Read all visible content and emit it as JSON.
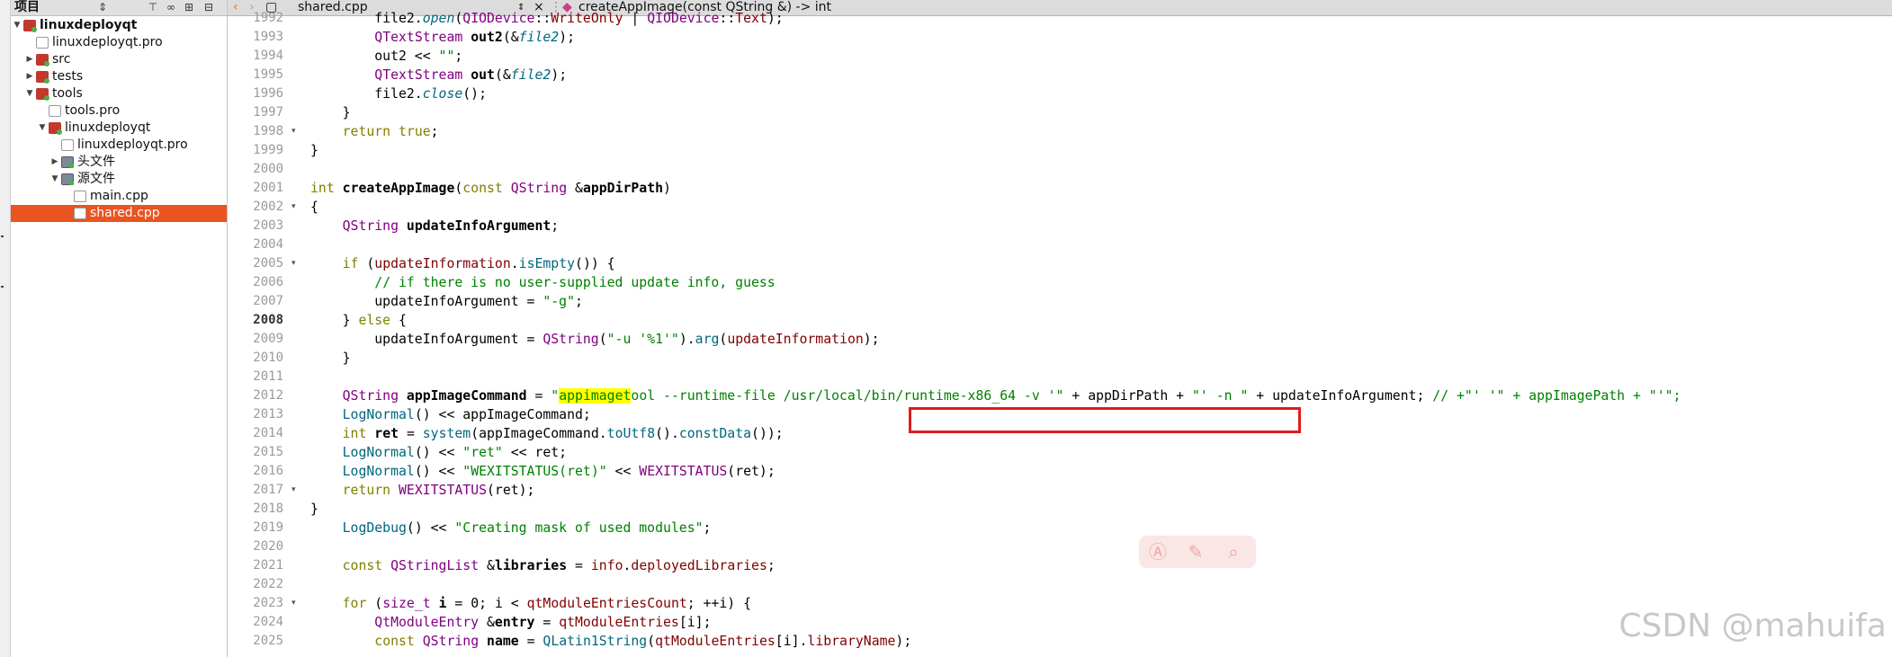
{
  "sidebar": {
    "title": "项目",
    "toolbar_icons": [
      "sort-updown-icon",
      "filter-icon",
      "link-icon",
      "split-add-icon",
      "close-panel-icon"
    ],
    "tree": [
      {
        "label": "linuxdeployqt",
        "kind": "project",
        "level": 0,
        "expanded": true,
        "bold": true
      },
      {
        "label": "linuxdeployqt.pro",
        "kind": "file",
        "level": 1
      },
      {
        "label": "src",
        "kind": "project",
        "level": 1,
        "expanded": false
      },
      {
        "label": "tests",
        "kind": "project",
        "level": 1,
        "expanded": false
      },
      {
        "label": "tools",
        "kind": "project",
        "level": 1,
        "expanded": true
      },
      {
        "label": "tools.pro",
        "kind": "file",
        "level": 2
      },
      {
        "label": "linuxdeployqt",
        "kind": "project",
        "level": 2,
        "expanded": true
      },
      {
        "label": "linuxdeployqt.pro",
        "kind": "file",
        "level": 3
      },
      {
        "label": "头文件",
        "kind": "folder",
        "level": 3,
        "expanded": false
      },
      {
        "label": "源文件",
        "kind": "folder",
        "level": 3,
        "expanded": true
      },
      {
        "label": "main.cpp",
        "kind": "file",
        "level": 4
      },
      {
        "label": "shared.cpp",
        "kind": "file",
        "level": 4,
        "selected": true
      }
    ]
  },
  "tabbar": {
    "filename": "shared.cpp",
    "function_signature": "createAppImage(const QString &) -> int"
  },
  "editor": {
    "current_line": "2008",
    "lines": [
      {
        "n": "1992",
        "fold": "",
        "html": "        file2.<span class=\"fn\">open</span>(<span class=\"t\">QIODevice</span>::<span class=\"m\">WriteOnly</span> | <span class=\"t\">QIODevice</span>::<span class=\"m\">Text</span>);"
      },
      {
        "n": "1993",
        "fold": "",
        "html": "        <span class=\"t\">QTextStream</span> <span class=\"b\">out2</span>(&amp;<span class=\"fn\">file2</span>);"
      },
      {
        "n": "1994",
        "fold": "",
        "html": "        out2 &lt;&lt; <span class=\"s\">\"\"</span>;"
      },
      {
        "n": "1995",
        "fold": "",
        "html": "        <span class=\"t\">QTextStream</span> <span class=\"b\">out</span>(&amp;<span class=\"fn\">file2</span>);"
      },
      {
        "n": "1996",
        "fold": "",
        "html": "        file2.<span class=\"fn\">close</span>();"
      },
      {
        "n": "1997",
        "fold": "",
        "html": "    }"
      },
      {
        "n": "1998",
        "fold": "▾",
        "html": "    <span class=\"k\">return</span> <span class=\"k\">true</span>;"
      },
      {
        "n": "1999",
        "fold": "",
        "html": "}"
      },
      {
        "n": "2000",
        "fold": "",
        "html": ""
      },
      {
        "n": "2001",
        "fold": "",
        "html": "<span class=\"k\">int</span> <span class=\"b\">createAppImage</span>(<span class=\"k\">const</span> <span class=\"t\">QString</span> &amp;<span class=\"b\">appDirPath</span>)"
      },
      {
        "n": "2002",
        "fold": "▾",
        "html": "{"
      },
      {
        "n": "2003",
        "fold": "",
        "html": "    <span class=\"t\">QString</span> <span class=\"b\">updateInfoArgument</span>;"
      },
      {
        "n": "2004",
        "fold": "",
        "html": ""
      },
      {
        "n": "2005",
        "fold": "▾",
        "html": "    <span class=\"k\">if</span> (<span class=\"m\">updateInformation</span>.<span class=\"f\">isEmpty</span>()) {"
      },
      {
        "n": "2006",
        "fold": "",
        "html": "        <span class=\"c\">// if there is no user-supplied update info, guess</span>"
      },
      {
        "n": "2007",
        "fold": "",
        "html": "        updateInfoArgument = <span class=\"s\">\"-g\"</span>;"
      },
      {
        "n": "2008",
        "fold": "",
        "html": "    } <span class=\"k\">else</span> {"
      },
      {
        "n": "2009",
        "fold": "",
        "html": "        updateInfoArgument = <span class=\"t\">QString</span>(<span class=\"s\">\"-u '%1'\"</span>).<span class=\"f\">arg</span>(<span class=\"m\">updateInformation</span>);"
      },
      {
        "n": "2010",
        "fold": "",
        "html": "    }"
      },
      {
        "n": "2011",
        "fold": "",
        "html": ""
      },
      {
        "n": "2012",
        "fold": "",
        "html": "    <span class=\"t\">QString</span> <span class=\"b\">appImageCommand</span> = <span class=\"s\">\"<span class=\"hl\">appimaget</span>ool --runtime-file /usr/local/bin/runtime-x86_64 -v '\"</span> + appDirPath + <span class=\"s\">\"' -n \"</span> + updateInfoArgument; <span class=\"c\">// +\"' '\" + appImagePath + \"'\";</span>"
      },
      {
        "n": "2013",
        "fold": "",
        "html": "    <span class=\"f\">LogNormal</span>() &lt;&lt; appImageCommand;"
      },
      {
        "n": "2014",
        "fold": "",
        "html": "    <span class=\"k\">int</span> <span class=\"b\">ret</span> = <span class=\"f\">system</span>(appImageCommand.<span class=\"f\">toUtf8</span>().<span class=\"f\">constData</span>());"
      },
      {
        "n": "2015",
        "fold": "",
        "html": "    <span class=\"f\">LogNormal</span>() &lt;&lt; <span class=\"s\">\"ret\"</span> &lt;&lt; ret;"
      },
      {
        "n": "2016",
        "fold": "",
        "html": "    <span class=\"f\">LogNormal</span>() &lt;&lt; <span class=\"s\">\"WEXITSTATUS(ret)\"</span> &lt;&lt; <span class=\"t\">WEXITSTATUS</span>(ret);"
      },
      {
        "n": "2017",
        "fold": "▾",
        "html": "    <span class=\"k\">return</span> <span class=\"t\">WEXITSTATUS</span>(ret);"
      },
      {
        "n": "2018",
        "fold": "",
        "html": "}"
      },
      {
        "n": "2019",
        "fold": "",
        "html": "    <span class=\"f\">LogDebug</span>() &lt;&lt; <span class=\"s\">\"Creating mask of used modules\"</span>;"
      },
      {
        "n": "2020",
        "fold": "",
        "html": ""
      },
      {
        "n": "2021",
        "fold": "",
        "html": "    <span class=\"k\">const</span> <span class=\"t\">QStringList</span> &amp;<span class=\"b\">libraries</span> = <span class=\"m\">info</span>.<span class=\"m\">deployedLibraries</span>;"
      },
      {
        "n": "2022",
        "fold": "",
        "html": ""
      },
      {
        "n": "2023",
        "fold": "▾",
        "html": "    <span class=\"k\">for</span> (<span class=\"t\">size_t</span> <span class=\"b\">i</span> = 0; i &lt; <span class=\"m\">qtModuleEntriesCount</span>; ++i) {"
      },
      {
        "n": "2024",
        "fold": "",
        "html": "        <span class=\"t\">QtModuleEntry</span> &amp;<span class=\"b\">entry</span> = <span class=\"m\">qtModuleEntries</span>[i];"
      },
      {
        "n": "2025",
        "fold": "",
        "html": "        <span class=\"k\">const</span> <span class=\"t\">QString</span> <span class=\"b\">name</span> = <span class=\"f\">QLatin1String</span>(<span class=\"m\">qtModuleEntries</span>[i].<span class=\"m\">libraryName</span>);"
      }
    ]
  },
  "floating_toolbar": {
    "icons": [
      "ai-icon",
      "magic-wand-icon",
      "search-icon"
    ]
  },
  "watermark": "CSDN @mahuifa",
  "colors": {
    "selection": "#e95420",
    "highlight_box": "#e11b1b",
    "search_highlight": "#ffff00"
  }
}
